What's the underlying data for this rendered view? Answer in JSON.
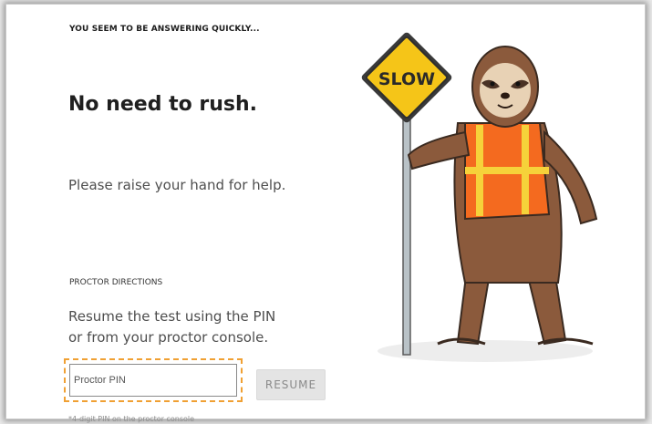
{
  "notice": {
    "eyebrow": "YOU SEEM TO BE ANSWERING QUICKLY...",
    "heading": "No need to rush.",
    "help_text": "Please raise your hand for help."
  },
  "proctor": {
    "section_label": "PROCTOR DIRECTIONS",
    "directions_line1": "Resume the test using the PIN",
    "directions_line2": "or from your proctor console.",
    "pin_placeholder": "Proctor PIN",
    "resume_label": "RESUME",
    "pin_hint": "*4-digit PIN on the proctor console"
  },
  "illustration": {
    "sign_text": "SLOW",
    "icon": "sloth-with-slow-sign",
    "colors": {
      "sign": "#f5c518",
      "vest": "#f46a1f",
      "stripe": "#f6d23a",
      "fur": "#8b5a3c"
    }
  }
}
